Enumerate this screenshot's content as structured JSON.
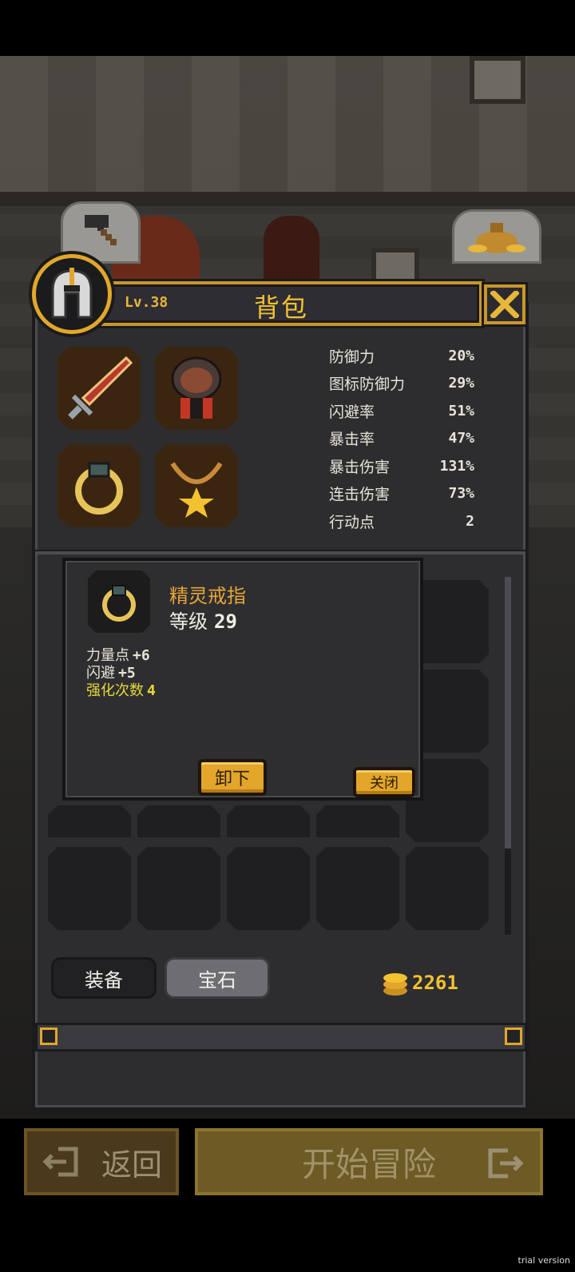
{
  "header": {
    "level": "Lv.38",
    "title": "背包"
  },
  "stats": [
    {
      "label": "防御力",
      "value": "20%"
    },
    {
      "label": "图标防御力",
      "value": "29%"
    },
    {
      "label": "闪避率",
      "value": "51%"
    },
    {
      "label": "暴击率",
      "value": "47%"
    },
    {
      "label": "暴击伤害",
      "value": "131%"
    },
    {
      "label": "连击伤害",
      "value": "73%"
    },
    {
      "label": "行动点",
      "value": "2"
    }
  ],
  "popup": {
    "item_name": "精灵戒指",
    "level_label": "等级",
    "level_value": "29",
    "attributes": [
      {
        "label": "力量点",
        "value": "+6"
      },
      {
        "label": "闪避",
        "value": "+5"
      },
      {
        "label": "强化次数",
        "value": "4"
      }
    ],
    "unequip_label": "卸下",
    "close_label": "关闭"
  },
  "tabs": {
    "equipment": "装备",
    "gems": "宝石"
  },
  "gold": "2261",
  "nav": {
    "back": "返回",
    "start": "开始冒险"
  },
  "footer": {
    "trial": "trial version"
  },
  "colors": {
    "accent_gold": "#e3a62a",
    "title_yellow": "#f2c230",
    "item_name_orange": "#e8a638",
    "enhance_yellow": "#e7d83a"
  }
}
